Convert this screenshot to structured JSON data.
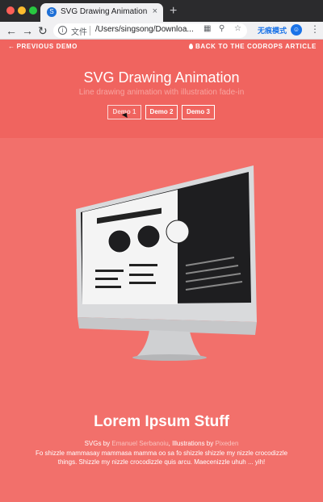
{
  "browser": {
    "tab_title": "SVG Drawing Animation | Codrops",
    "tab_close": "×",
    "new_tab": "+",
    "favicon": "S",
    "omnibox_label": "文件",
    "url": "/Users/singsong/Downloa...",
    "mode_label": "无痕模式",
    "avatar_text": "☺",
    "icons": [
      "back-arrow-icon",
      "forward-arrow-icon",
      "reload-icon",
      "info-icon",
      "translate-icon",
      "zoom-icon",
      "star-icon",
      "menu-icon"
    ]
  },
  "page": {
    "nav_prev": "PREVIOUS DEMO",
    "nav_back": "BACK TO THE CODROPS ARTICLE",
    "title": "SVG Drawing Animation",
    "subtitle": "Line drawing animation with illustration fade-in",
    "demos": [
      "Demo 1",
      "Demo 2",
      "Demo 3"
    ],
    "section_title": "Lorem Ipsum Stuff",
    "credits_prefix": "SVGs by ",
    "credits_author1": "Emanuel Serbanoiu",
    "credits_mid": ", Illustrations by ",
    "credits_author2": "Pixeden",
    "body": "Fo shizzle mammasay mammasa mamma oo sa fo shizzle shizzle my nizzle crocodizzle things. Shizzle my nizzle crocodizzle quis arcu. Maecenizzle uhuh ... yih!"
  },
  "colors": {
    "background": "#f2706b",
    "header_band": "#f0645f",
    "accent_link": "#f9c3bf"
  }
}
